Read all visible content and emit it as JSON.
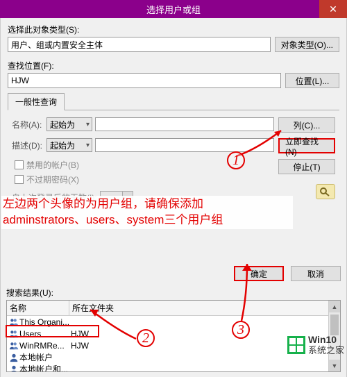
{
  "title": "选择用户或组",
  "close_glyph": "✕",
  "object_type_label": "选择此对象类型(S):",
  "object_type_value": "用户、组或内置安全主体",
  "object_type_btn": "对象类型(O)...",
  "location_label": "查找位置(F):",
  "location_value": "HJW",
  "location_btn": "位置(L)...",
  "tab_general": "一般性查询",
  "name_label": "名称(A):",
  "name_mode": "起始为",
  "desc_label": "描述(D):",
  "desc_mode": "起始为",
  "chk_disabled": "禁用的帐户(B)",
  "chk_neverexpire": "不过期密码(X)",
  "days_label": "自上次登录后的天数(I):",
  "btn_columns": "列(C)...",
  "btn_findnow": "立即查找(N)",
  "btn_stop": "停止(T)",
  "annotation_text_1": "左边两个头像的为用户组，请确保添加",
  "annotation_text_2": "adminstrators、users、system三个用户组",
  "btn_ok": "确定",
  "btn_cancel": "取消",
  "results_label": "搜索结果(U):",
  "col_name": "名称",
  "col_folder": "所在文件夹",
  "rows": [
    {
      "icon": "group",
      "name": "This Organi...",
      "folder": ""
    },
    {
      "icon": "group",
      "name": "Users",
      "folder": "HJW"
    },
    {
      "icon": "group",
      "name": "WinRMRe...",
      "folder": "HJW"
    },
    {
      "icon": "user",
      "name": "本地帐户",
      "folder": ""
    },
    {
      "icon": "user",
      "name": "本地帐户和...",
      "folder": ""
    }
  ],
  "num1": "1",
  "num2": "2",
  "num3": "3",
  "wm_top": "Win10",
  "wm_bottom": "系统之家"
}
